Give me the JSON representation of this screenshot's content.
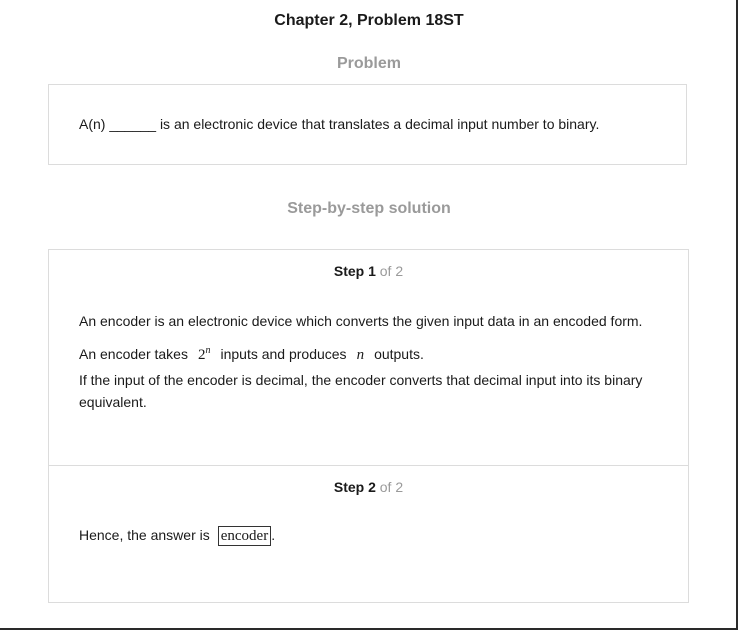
{
  "header": {
    "chapter_title": "Chapter 2, Problem 18ST"
  },
  "problem": {
    "heading": "Problem",
    "text": "A(n) ______ is an electronic device that translates a decimal input number to binary."
  },
  "solution": {
    "heading": "Step-by-step solution",
    "steps": [
      {
        "label": "Step 1",
        "of": "of 2",
        "paragraphs": {
          "p1": "An encoder is an electronic device which converts the given input data in an encoded form.",
          "p2_before": "An encoder takes",
          "p2_math_base": "2",
          "p2_math_exp": "n",
          "p2_middle": "inputs and produces",
          "p2_math_var": "n",
          "p2_after": "outputs.",
          "p3": "If the input of the encoder is decimal, the encoder converts that decimal input into its binary equivalent."
        }
      },
      {
        "label": "Step 2",
        "of": "of 2",
        "answer_prefix": "Hence, the answer is",
        "answer_value": "encoder",
        "answer_suffix": "."
      }
    ]
  }
}
